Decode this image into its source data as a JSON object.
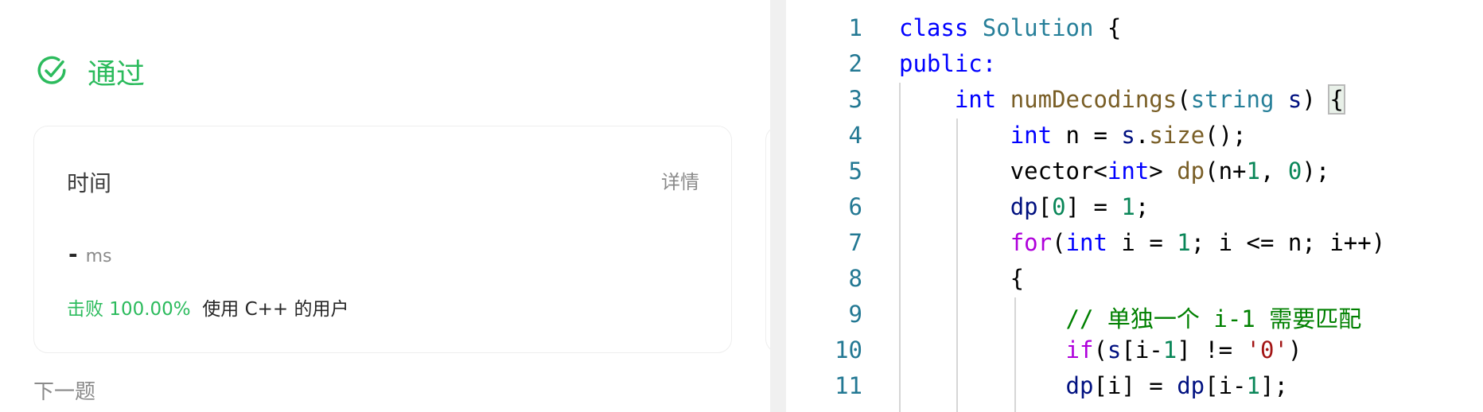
{
  "result": {
    "status": "通过",
    "icon": "check-circle-icon",
    "color": "#2cbb5d"
  },
  "time_card": {
    "title": "时间",
    "detail_link": "详情",
    "value": "-",
    "unit": "ms",
    "beat_label": "击败 100.00%",
    "beat_suffix": "使用 C++ 的用户"
  },
  "next_label": "下一题",
  "editor": {
    "line_numbers": [
      "1",
      "2",
      "3",
      "4",
      "5",
      "6",
      "7",
      "8",
      "9",
      "10",
      "11"
    ],
    "lines": [
      [
        [
          "k",
          "class"
        ],
        [
          "",
          ""
        ],
        [
          "",
          ""
        ],
        [
          "",
          " "
        ],
        [
          "t",
          "Solution"
        ],
        [
          "",
          " {"
        ]
      ],
      [
        [
          "k",
          "public:"
        ]
      ],
      [
        [
          "",
          "    "
        ],
        [
          "k",
          "int"
        ],
        [
          "",
          " "
        ],
        [
          "f",
          "numDecodings"
        ],
        [
          "",
          "("
        ],
        [
          "t",
          "string"
        ],
        [
          "",
          " "
        ],
        [
          "v",
          "s"
        ],
        [
          "",
          ") "
        ],
        [
          "bm",
          "{"
        ]
      ],
      [
        [
          "",
          "        "
        ],
        [
          "k",
          "int"
        ],
        [
          "",
          " n = "
        ],
        [
          "v",
          "s"
        ],
        [
          "",
          "."
        ],
        [
          "f",
          "size"
        ],
        [
          "",
          "();"
        ]
      ],
      [
        [
          "",
          "        vector<"
        ],
        [
          "k",
          "int"
        ],
        [
          "",
          "> "
        ],
        [
          "f",
          "dp"
        ],
        [
          "",
          "(n+"
        ],
        [
          "n",
          "1"
        ],
        [
          "",
          ", "
        ],
        [
          "n",
          "0"
        ],
        [
          "",
          ");"
        ]
      ],
      [
        [
          "",
          "        "
        ],
        [
          "v",
          "dp"
        ],
        [
          "",
          "["
        ],
        [
          "n",
          "0"
        ],
        [
          "",
          "] = "
        ],
        [
          "n",
          "1"
        ],
        [
          "",
          ";"
        ]
      ],
      [
        [
          "",
          "        "
        ],
        [
          "c",
          "for"
        ],
        [
          "",
          "("
        ],
        [
          "k",
          "int"
        ],
        [
          "",
          " i = "
        ],
        [
          "n",
          "1"
        ],
        [
          "",
          "; i <= n; i++)"
        ]
      ],
      [
        [
          "",
          "        {"
        ]
      ],
      [
        [
          "",
          "            "
        ],
        [
          "cm",
          "// 单独一个 i-1 需要匹配"
        ]
      ],
      [
        [
          "",
          "            "
        ],
        [
          "c",
          "if"
        ],
        [
          "",
          "("
        ],
        [
          "v",
          "s"
        ],
        [
          "",
          "[i-"
        ],
        [
          "n",
          "1"
        ],
        [
          "",
          "] != "
        ],
        [
          "s",
          "'0'"
        ],
        [
          "",
          ")"
        ]
      ],
      [
        [
          "",
          "            "
        ],
        [
          "v",
          "dp"
        ],
        [
          "",
          "[i] = "
        ],
        [
          "v",
          "dp"
        ],
        [
          "",
          "[i-"
        ],
        [
          "n",
          "1"
        ],
        [
          "",
          "];"
        ]
      ]
    ]
  }
}
